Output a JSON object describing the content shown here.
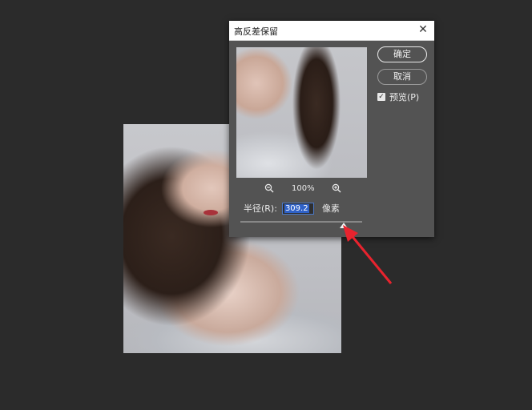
{
  "dialog": {
    "title": "高反差保留",
    "close_glyph": "✕",
    "ok_label": "确定",
    "cancel_label": "取消",
    "preview_label": "预览(P)",
    "preview_checked": true,
    "zoom_level": "100%",
    "radius_label": "半径(R):",
    "radius_value": "309.2",
    "radius_unit": "像素"
  },
  "annotation": {
    "arrow_color": "#e8232e"
  }
}
